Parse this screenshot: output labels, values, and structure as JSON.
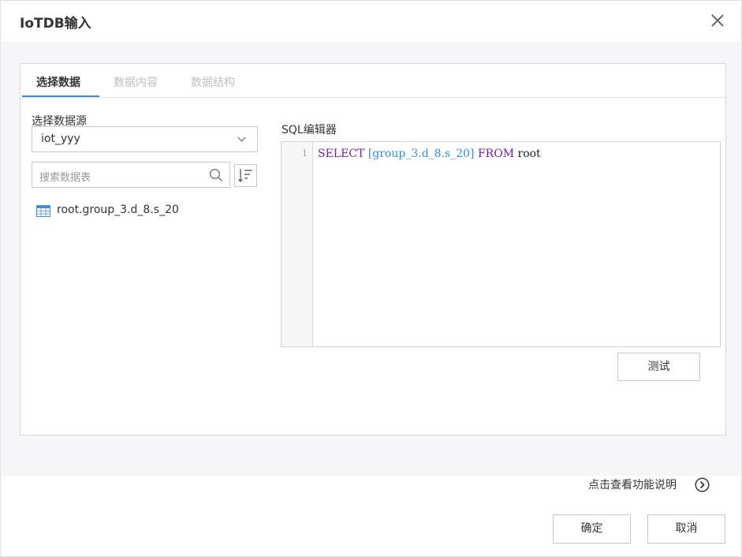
{
  "dialog": {
    "title": "IoTDB输入"
  },
  "tabs": [
    {
      "label": "选择数据",
      "active": true
    },
    {
      "label": "数据内容",
      "active": false
    },
    {
      "label": "数据结构",
      "active": false
    }
  ],
  "source": {
    "label": "选择数据源",
    "selected": "iot_yyy",
    "search_placeholder": "搜索数据表",
    "tables": [
      "root.group_3.d_8.s_20"
    ]
  },
  "sql": {
    "label": "SQL编辑器",
    "line_number": "1",
    "tokens": {
      "select": "SELECT",
      "ident": "[group_3.d_8.s_20]",
      "from": "FROM",
      "table": "root"
    },
    "test_label": "测试"
  },
  "footer": {
    "help_text": "点击查看功能说明",
    "ok_label": "确定",
    "cancel_label": "取消"
  },
  "colors": {
    "accent": "#3f8ed8",
    "keyword": "#7a1da6",
    "identifier": "#2f8fd8"
  }
}
